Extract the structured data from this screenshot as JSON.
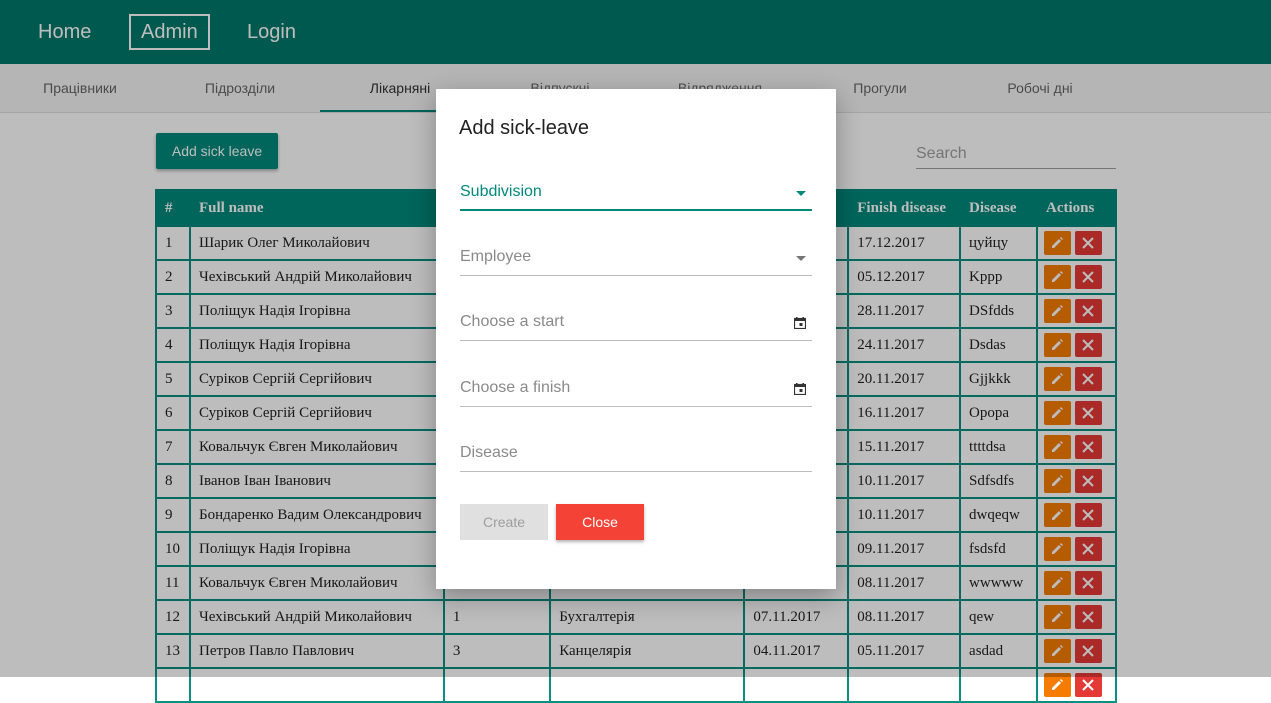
{
  "topnav": {
    "items": [
      {
        "label": "Home",
        "active": false
      },
      {
        "label": "Admin",
        "active": true
      },
      {
        "label": "Login",
        "active": false
      }
    ]
  },
  "tabs": [
    {
      "label": "Працівники",
      "active": false
    },
    {
      "label": "Підрозділи",
      "active": false
    },
    {
      "label": "Лікарняні",
      "active": true
    },
    {
      "label": "Відпускні",
      "active": false
    },
    {
      "label": "Відрядження",
      "active": false
    },
    {
      "label": "Прогули",
      "active": false
    },
    {
      "label": "Робочі дні",
      "active": false
    }
  ],
  "toolbar": {
    "add_label": "Add sick leave",
    "search_placeholder": "Search"
  },
  "table": {
    "headers": [
      "#",
      "Full name",
      "",
      "",
      "",
      "Finish disease",
      "Disease",
      "Actions"
    ],
    "rows": [
      [
        "1",
        "Шарик Олег Миколайович",
        "",
        "",
        "",
        "17.12.2017",
        "цуйцу"
      ],
      [
        "2",
        "Чехівський Андрій Миколайович",
        "",
        "",
        "",
        "05.12.2017",
        "Kppp"
      ],
      [
        "3",
        "Поліщук Надія Ігорівна",
        "",
        "",
        "",
        "28.11.2017",
        "DSfdds"
      ],
      [
        "4",
        "Поліщук Надія Ігорівна",
        "",
        "",
        "",
        "24.11.2017",
        "Dsdas"
      ],
      [
        "5",
        "Суріков Сергій Сергійович",
        "",
        "",
        "",
        "20.11.2017",
        "Gjjkkk"
      ],
      [
        "6",
        "Суріков Сергій Сергійович",
        "",
        "",
        "",
        "16.11.2017",
        "Opopa"
      ],
      [
        "7",
        "Ковальчук Євген Миколайович",
        "",
        "",
        "",
        "15.11.2017",
        "ttttdsa"
      ],
      [
        "8",
        "Іванов Іван Іванович",
        "",
        "",
        "",
        "10.11.2017",
        "Sdfsdfs"
      ],
      [
        "9",
        "Бондаренко Вадим Олександрович",
        "",
        "",
        "",
        "10.11.2017",
        "dwqeqw"
      ],
      [
        "10",
        "Поліщук Надія Ігорівна",
        "",
        "",
        "",
        "09.11.2017",
        "fsdsfd"
      ],
      [
        "11",
        "Ковальчук Євген Миколайович",
        "",
        "",
        "",
        "08.11.2017",
        "wwwww"
      ],
      [
        "12",
        "Чехівський Андрій Миколайович",
        "1",
        "Бухгалтерія",
        "07.11.2017",
        "08.11.2017",
        "qew"
      ],
      [
        "13",
        "Петров Павло Павлович",
        "3",
        "Канцелярія",
        "04.11.2017",
        "05.11.2017",
        "asdad"
      ],
      [
        "",
        "",
        "",
        "",
        "",
        "",
        ""
      ]
    ]
  },
  "modal": {
    "title": "Add sick-leave",
    "fields": [
      {
        "label": "Subdivision",
        "kind": "select",
        "focused": true
      },
      {
        "label": "Employee",
        "kind": "select",
        "focused": false
      },
      {
        "label": "Choose a start",
        "kind": "date",
        "focused": false
      },
      {
        "label": "Choose a finish",
        "kind": "date",
        "focused": false
      },
      {
        "label": "Disease",
        "kind": "text",
        "focused": false
      }
    ],
    "create_label": "Create",
    "close_label": "Close"
  },
  "colors": {
    "primary": "#00796b",
    "accent": "#00897b",
    "edit": "#f57c00",
    "delete": "#e53935",
    "close": "#f44336"
  }
}
